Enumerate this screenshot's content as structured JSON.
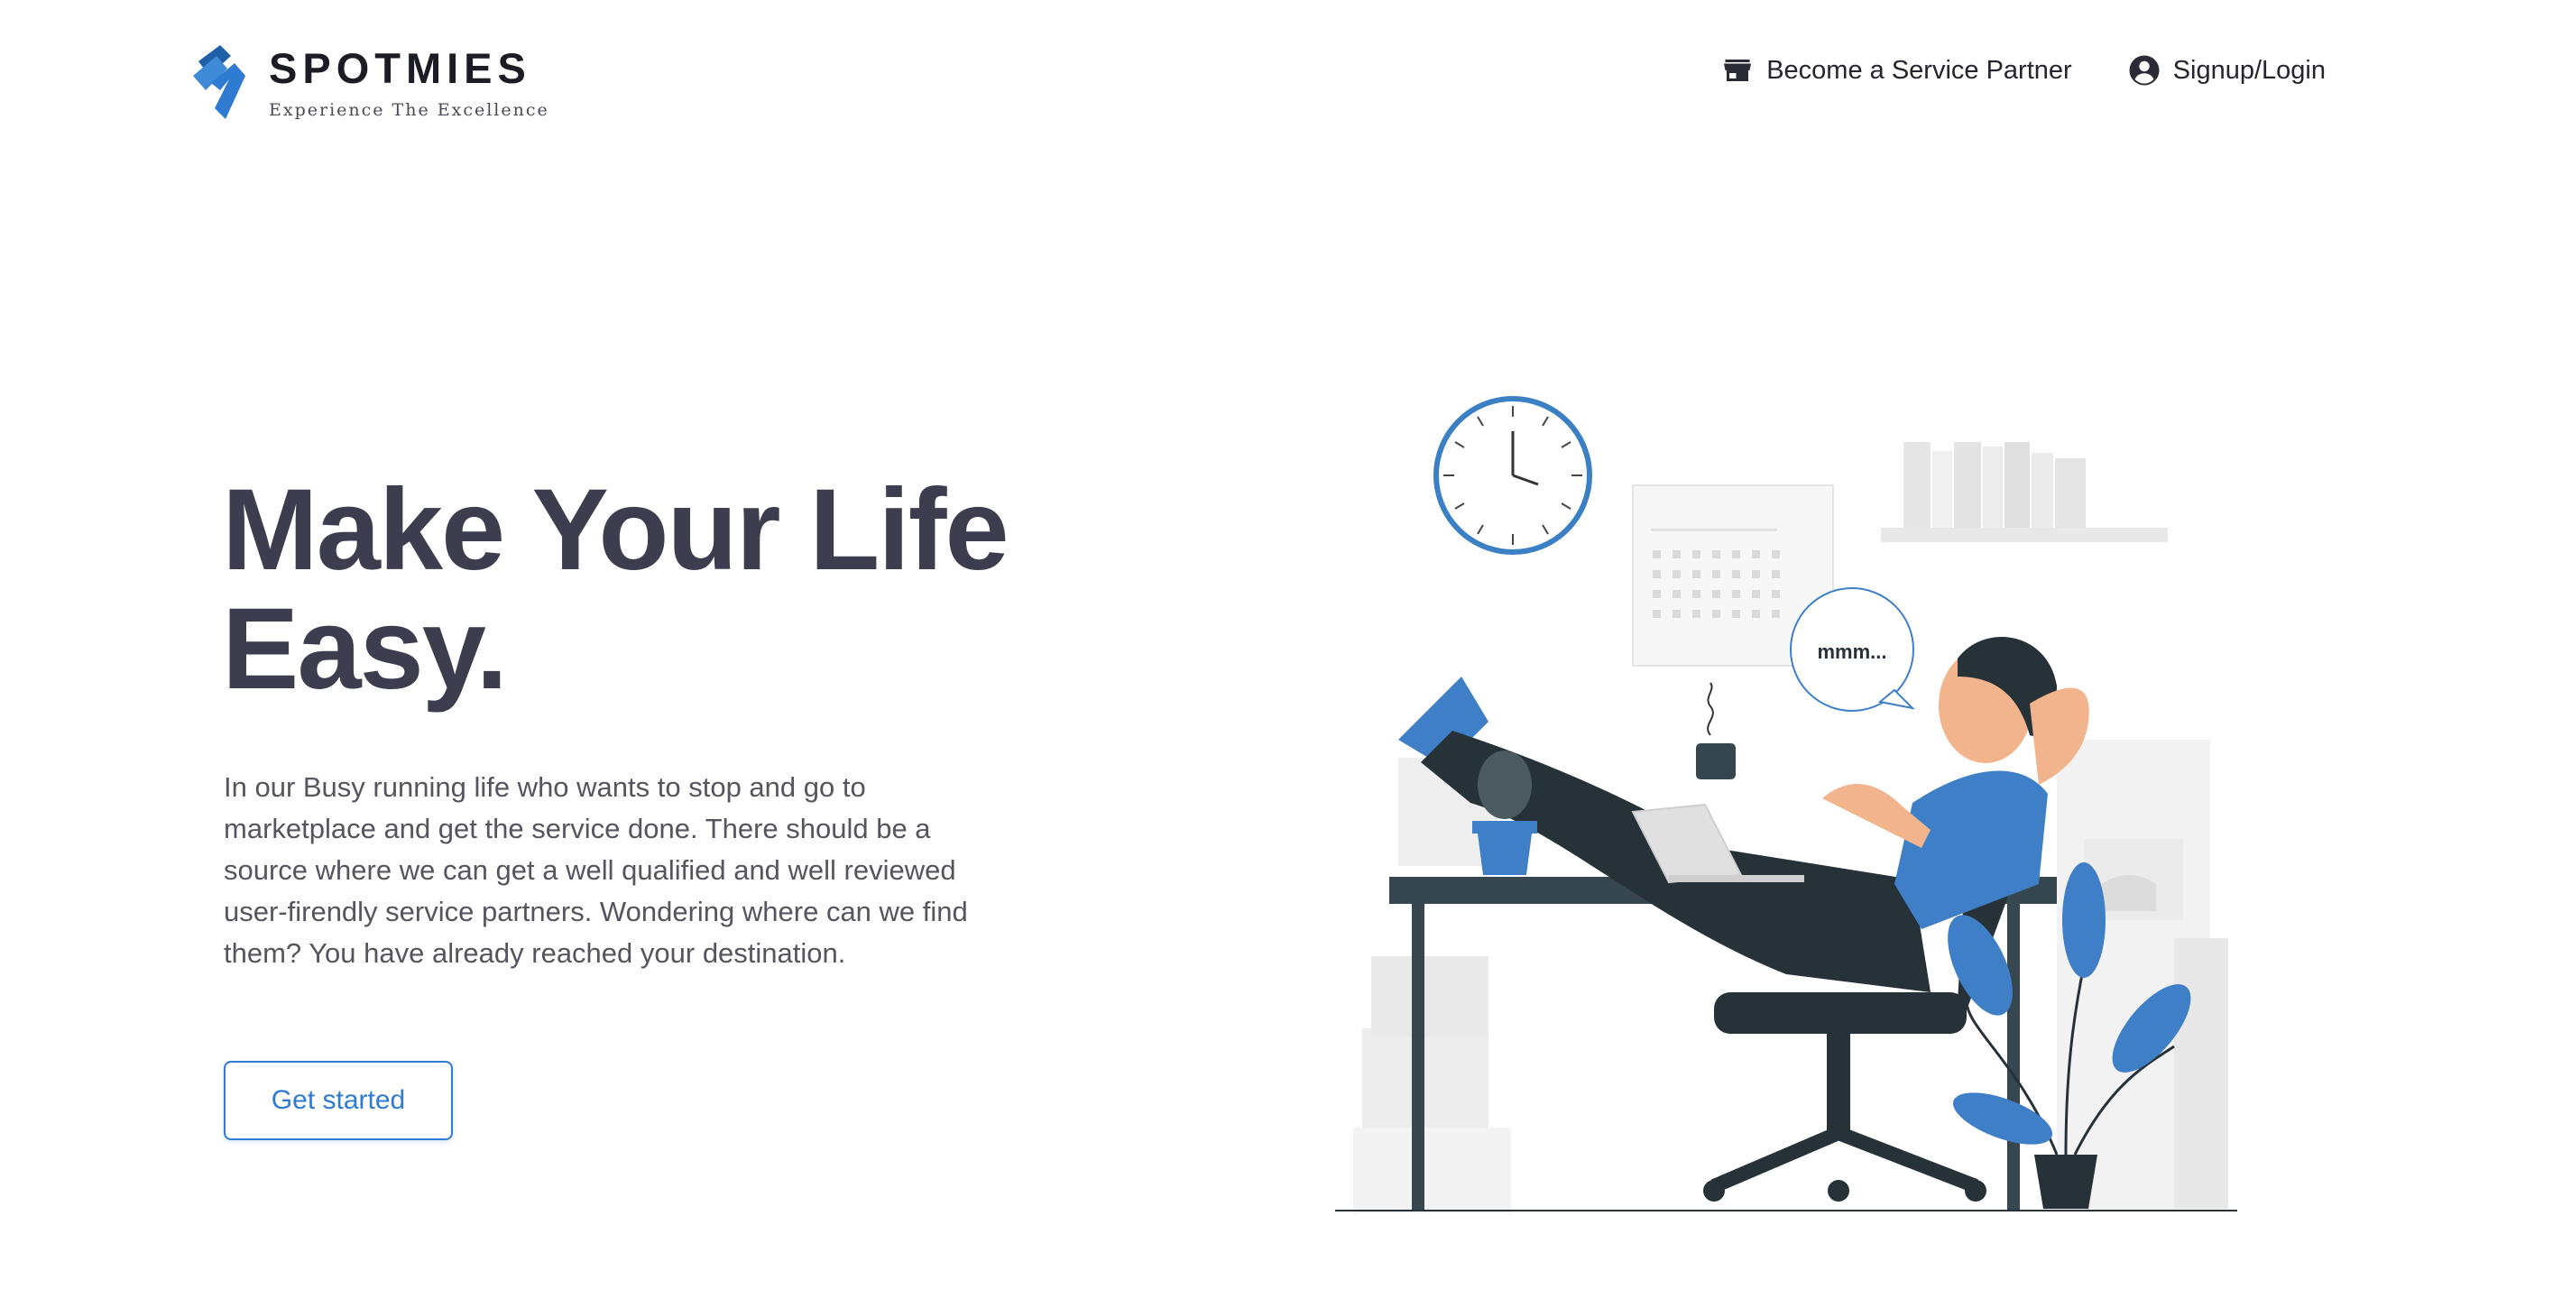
{
  "brand": {
    "name": "SPOTMIES",
    "tagline": "Experience The Excellence",
    "primary_color": "#2f7bd1"
  },
  "nav": {
    "partner": {
      "label": "Become a Service Partner",
      "icon": "storefront-icon"
    },
    "login": {
      "label": "Signup/Login",
      "icon": "account-circle-icon"
    }
  },
  "hero": {
    "title_line1": "Make Your Life",
    "title_line2": "Easy.",
    "description": "In our Busy running life who wants to stop and go to marketplace and get the service done. There should be a source where we can get a well qualified and well reviewed user-firendly service partners. Wondering where can we find them? You have already reached your destination.",
    "cta_label": "Get started"
  },
  "illustration": {
    "speech_bubble": "mmm..."
  }
}
